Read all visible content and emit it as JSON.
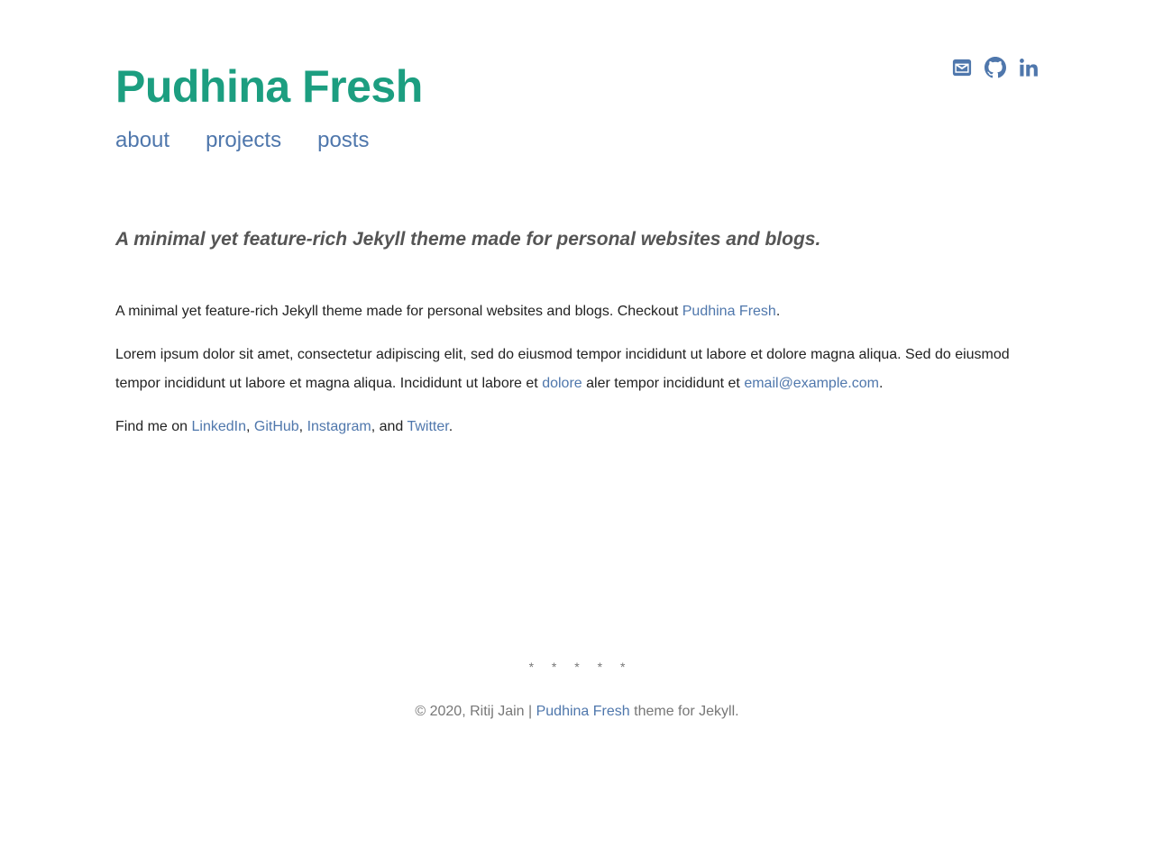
{
  "site": {
    "title": "Pudhina Fresh"
  },
  "nav": {
    "items": [
      {
        "label": "about"
      },
      {
        "label": "projects"
      },
      {
        "label": "posts"
      }
    ]
  },
  "social": {
    "icons": [
      "envelope-icon",
      "github-icon",
      "linkedin-icon"
    ]
  },
  "tagline": "A minimal yet feature-rich Jekyll theme made for personal websites and blogs.",
  "content": {
    "p1": {
      "text": "A minimal yet feature-rich Jekyll theme made for personal websites and blogs. Checkout ",
      "link": "Pudhina Fresh",
      "end": "."
    },
    "p2": {
      "text": "Lorem ipsum dolor sit amet, consectetur adipiscing elit, sed do eiusmod tempor incididunt ut labore et dolore magna aliqua. Sed do eiusmod tempor incididunt ut labore et magna aliqua. Incididunt ut labore et ",
      "link1": "dolore",
      "mid": " aler tempor incididunt et ",
      "link2": "email@example.com",
      "end": "."
    },
    "p3": {
      "text": "Find me on ",
      "linkedin": "LinkedIn",
      "sep1": ", ",
      "github": "GitHub",
      "sep2": ", ",
      "instagram": "Instagram",
      "sep3": ", and ",
      "twitter": "Twitter",
      "end": "."
    }
  },
  "footer": {
    "stars": "* * * * *",
    "copyright": "© 2020, Ritij Jain | ",
    "link": "Pudhina Fresh",
    "suffix": " theme for Jekyll."
  },
  "colors": {
    "title": "#1c9e80",
    "link": "#4f77ac",
    "tagline": "#555555",
    "footer": "#777777"
  }
}
